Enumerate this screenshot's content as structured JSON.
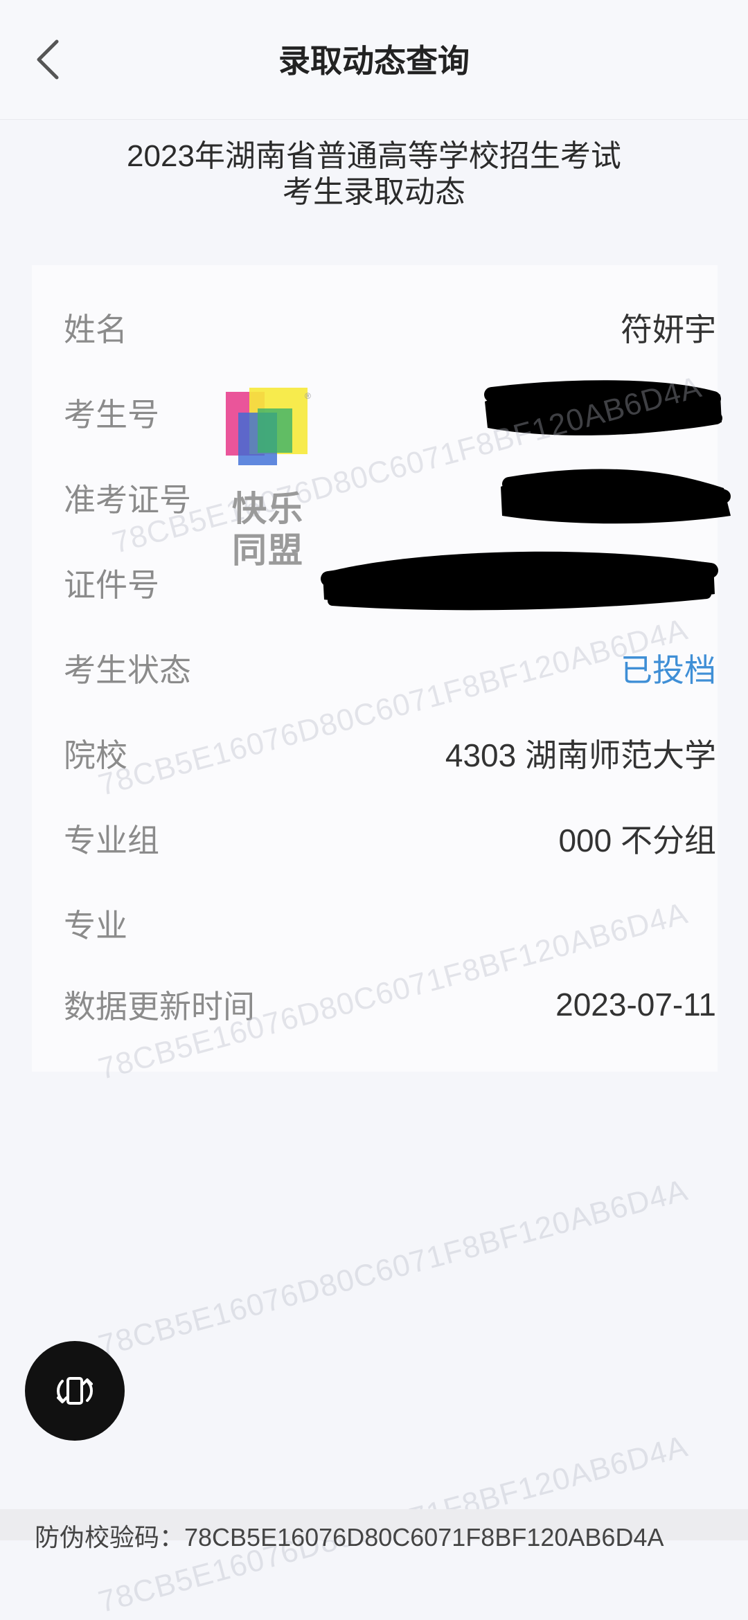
{
  "header": {
    "title": "录取动态查询"
  },
  "subtitle": {
    "line1": "2023年湖南省普通高等学校招生考试",
    "line2": "考生录取动态"
  },
  "fields": {
    "name": {
      "label": "姓名",
      "value": "符妍宇"
    },
    "exam_number": {
      "label": "考生号"
    },
    "admission_ticket": {
      "label": "准考证号"
    },
    "id_number": {
      "label": "证件号"
    },
    "status": {
      "label": "考生状态",
      "value": "已投档"
    },
    "school": {
      "label": "院校",
      "value": "4303 湖南师范大学"
    },
    "major_group": {
      "label": "专业组",
      "value": "000 不分组"
    },
    "major": {
      "label": "专业",
      "value": ""
    },
    "update_time": {
      "label": "数据更新时间",
      "value": "2023-07-11"
    }
  },
  "watermark": "78CB5E16076D80C6071F8BF120AB6D4A",
  "logo": {
    "line1": "快乐",
    "line2": "同盟"
  },
  "footer": {
    "text": "防伪校验码：78CB5E16076D80C6071F8BF120AB6D4A"
  },
  "colors": {
    "status_blue": "#3f8fd6",
    "background": "#f5f6fa"
  }
}
